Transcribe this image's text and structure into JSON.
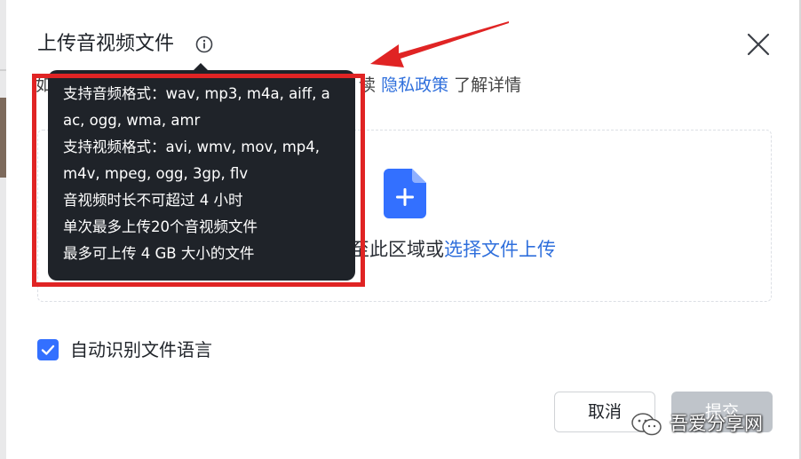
{
  "dialog": {
    "title": "上传音视频文件",
    "privacy": {
      "prefix": "如",
      "suffix_char": "读",
      "link": "隐私政策",
      "post": "了解详情"
    },
    "upload": {
      "hint_prefix": "至此区域或",
      "hint_link": "选择文件上传"
    },
    "checkbox": {
      "label": "自动识别文件语言",
      "checked": true
    },
    "buttons": {
      "cancel": "取消",
      "submit": "提交"
    }
  },
  "tooltip": {
    "lines": [
      "支持音频格式：wav, mp3, m4a, aiff, a",
      "ac, ogg, wma, amr",
      "支持视频格式：avi, wmv, mov, mp4,",
      "m4v, mpeg, ogg, 3gp, flv",
      "音视频时长不可超过 4 小时",
      "单次最多上传20个音视频文件",
      "最多可上传 4 GB 大小的文件"
    ]
  },
  "watermark": {
    "text": "吾爱分享网"
  },
  "colors": {
    "accent": "#3370ff",
    "link": "#2f6fdc",
    "tooltip_bg": "#1f2329",
    "annotation": "#e02424",
    "disabled": "#bfc4ca"
  },
  "icons": {
    "info": "info-icon",
    "close": "close-icon",
    "file": "file-plus-icon",
    "check": "check-icon",
    "wechat": "wechat-icon"
  }
}
